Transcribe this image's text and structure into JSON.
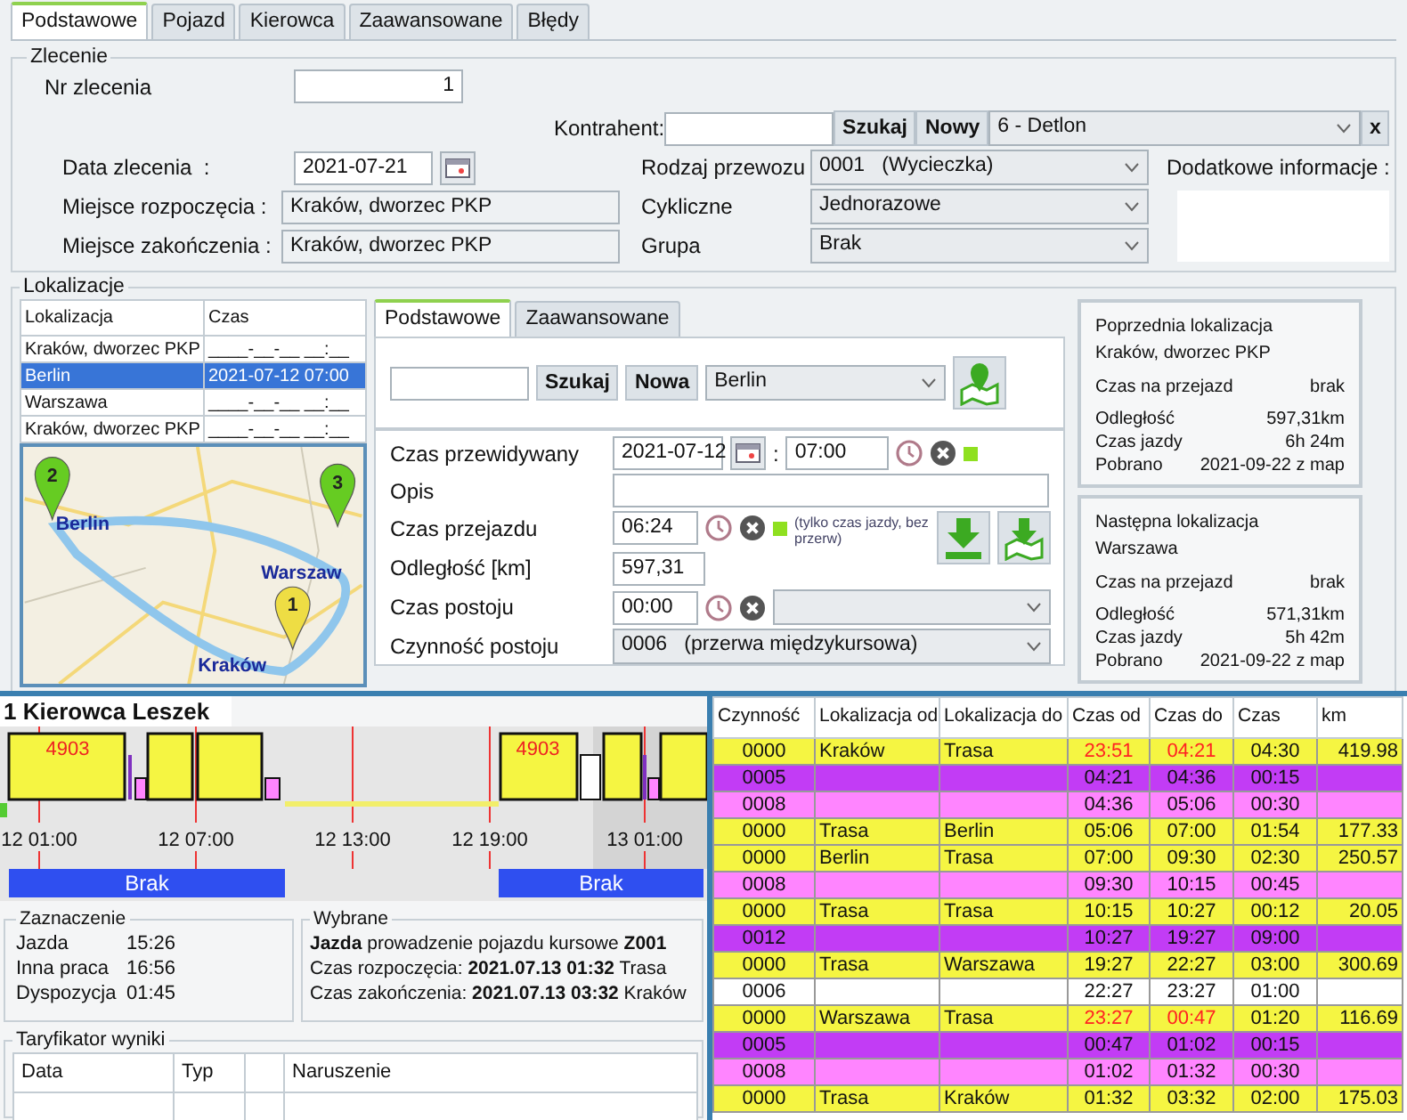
{
  "tabs": [
    {
      "label": "Podstawowe",
      "selected": true
    },
    {
      "label": "Pojazd",
      "selected": false
    },
    {
      "label": "Kierowca",
      "selected": false
    },
    {
      "label": "Zaawansowane",
      "selected": false
    },
    {
      "label": "Błędy",
      "selected": false
    }
  ],
  "zlecenie": {
    "legend": "Zlecenie",
    "left_fields": [
      {
        "label": "Nr zlecenia",
        "value": "1",
        "kind": "number"
      },
      {
        "label": "Data zlecenia  :",
        "value": "2021-07-21",
        "kind": "date"
      },
      {
        "label": "Miejsce rozpoczęcia :",
        "value": "Kraków, dworzec PKP",
        "kind": "readonly"
      },
      {
        "label": "Miejsce zakończenia :",
        "value": "Kraków, dworzec PKP",
        "kind": "readonly"
      }
    ],
    "kontrahent": {
      "label": "Kontrahent:",
      "search_button": "Szukaj",
      "new_button": "Nowy",
      "value": "6 - Detlon",
      "clear_button": "x"
    },
    "selects": [
      {
        "label": "Rodzaj przewozu",
        "value": "0001   (Wycieczka)"
      },
      {
        "label": "Cykliczne",
        "value": "Jednorazowe"
      },
      {
        "label": "Grupa",
        "value": "Brak"
      }
    ],
    "notes_label": "Dodatkowe informacje :"
  },
  "lokalizacje": {
    "legend": "Lokalizacje",
    "columns": [
      "Lokalizacja",
      "Czas"
    ],
    "rows": [
      {
        "name": "Kraków, dworzec PKP",
        "time": "____-__-__ __:__",
        "selected": false
      },
      {
        "name": "Berlin",
        "time": "2021-07-12 07:00",
        "selected": true
      },
      {
        "name": "Warszawa",
        "time": "____-__-__ __:__",
        "selected": false
      },
      {
        "name": "Kraków, dworzec PKP",
        "time": "____-__-__ __:__",
        "selected": false
      }
    ],
    "map": {
      "markers": [
        {
          "number": "2",
          "label": "Berlin",
          "color": "#66cc22"
        },
        {
          "number": "3",
          "label": "Warszaw",
          "color": "#66cc22"
        },
        {
          "number": "1",
          "label": "Kraków",
          "color": "#eedd44"
        }
      ]
    },
    "detail": {
      "tabs": [
        {
          "label": "Podstawowe",
          "selected": true
        },
        {
          "label": "Zaawansowane",
          "selected": false
        }
      ],
      "search_button": "Szukaj",
      "new_button": "Nowa",
      "location": "Berlin",
      "planned": {
        "label": "Czas przewidywany",
        "date": "2021-07-12",
        "separator": ":",
        "time": "07:00"
      },
      "description": {
        "label": "Opis"
      },
      "travel_time": {
        "label": "Czas przejazdu",
        "value": "06:24",
        "note": "(tylko czas jazdy, bez przerw)"
      },
      "distance": {
        "label": "Odległość [km]",
        "value": "597,31"
      },
      "stop_time": {
        "label": "Czas postoju",
        "value": "00:00"
      },
      "stop_activity": {
        "label": "Czynność postoju",
        "value": "0006   (przerwa międzykursowa)"
      }
    },
    "neighbors": [
      {
        "title": "Poprzednia lokalizacja",
        "name": "Kraków, dworzec PKP",
        "rows": [
          {
            "label": "Czas na przejazd",
            "value": "brak"
          },
          {
            "label": "Odległość",
            "value": "597,31km"
          },
          {
            "label": "Czas jazdy",
            "value": "6h 24m"
          },
          {
            "label": "Pobrano",
            "value": "2021-09-22 z map"
          }
        ]
      },
      {
        "title": "Następna lokalizacja",
        "name": "Warszawa",
        "rows": [
          {
            "label": "Czas na przejazd",
            "value": "brak"
          },
          {
            "label": "Odległość",
            "value": "571,31km"
          },
          {
            "label": "Czas jazdy",
            "value": "5h 42m"
          },
          {
            "label": "Pobrano",
            "value": "2021-09-22 z map"
          }
        ]
      }
    ]
  },
  "timeline": {
    "title": "1 Kierowca Leszek",
    "block_labels": [
      "4903",
      "4903"
    ],
    "ticks": [
      "12 01:00",
      "12 07:00",
      "12 13:00",
      "12 19:00",
      "13 01:00"
    ],
    "bars": [
      "Brak",
      "Brak"
    ]
  },
  "zaznaczenie": {
    "legend": "Zaznaczenie",
    "rows": [
      {
        "label": "Jazda",
        "value": "15:26"
      },
      {
        "label": "Inna praca",
        "value": "16:56"
      },
      {
        "label": "Dyspozycja",
        "value": "01:45"
      }
    ]
  },
  "wybrane": {
    "legend": "Wybrane",
    "lines": [
      "**Jazda** prowadzenie pojazdu kursowe **Z001**",
      "Czas rozpoczęcia: **2021.07.13 01:32** Trasa",
      "Czas zakończenia: **2021.07.13 03:32** Kraków"
    ]
  },
  "taryfikator": {
    "legend": "Taryfikator wyniki",
    "columns": [
      "Data",
      "Typ",
      "Naruszenie"
    ]
  },
  "activities": {
    "columns": [
      "Czynność",
      "Lokalizacja od",
      "Lokalizacja do",
      "Czas od",
      "Czas do",
      "Czas",
      "km"
    ],
    "rows": [
      {
        "code": "0000",
        "from": "Kraków",
        "to": "Trasa",
        "start": "23:51",
        "end": "04:21",
        "duration": "04:30",
        "km": "419.98",
        "color": "#f5f542",
        "time_alert": true
      },
      {
        "code": "0005",
        "start": "04:21",
        "end": "04:36",
        "duration": "00:15",
        "color": "#c23cf5",
        "time_alert": false
      },
      {
        "code": "0008",
        "start": "04:36",
        "end": "05:06",
        "duration": "00:30",
        "color": "#ff85ff",
        "time_alert": false
      },
      {
        "code": "0000",
        "from": "Trasa",
        "to": "Berlin",
        "start": "05:06",
        "end": "07:00",
        "duration": "01:54",
        "km": "177.33",
        "color": "#f5f542",
        "time_alert": false
      },
      {
        "code": "0000",
        "from": "Berlin",
        "to": "Trasa",
        "start": "07:00",
        "end": "09:30",
        "duration": "02:30",
        "km": "250.57",
        "color": "#f5f542",
        "time_alert": false
      },
      {
        "code": "0008",
        "start": "09:30",
        "end": "10:15",
        "duration": "00:45",
        "color": "#ff85ff",
        "time_alert": false
      },
      {
        "code": "0000",
        "from": "Trasa",
        "to": "Trasa",
        "start": "10:15",
        "end": "10:27",
        "duration": "00:12",
        "km": "20.05",
        "color": "#f5f542",
        "time_alert": false
      },
      {
        "code": "0012",
        "start": "10:27",
        "end": "19:27",
        "duration": "09:00",
        "color": "#c23cf5",
        "time_alert": false
      },
      {
        "code": "0000",
        "from": "Trasa",
        "to": "Warszawa",
        "start": "19:27",
        "end": "22:27",
        "duration": "03:00",
        "km": "300.69",
        "color": "#f5f542",
        "time_alert": false
      },
      {
        "code": "0006",
        "start": "22:27",
        "end": "23:27",
        "duration": "01:00",
        "color": "#ffffff",
        "time_alert": false
      },
      {
        "code": "0000",
        "from": "Warszawa",
        "to": "Trasa",
        "start": "23:27",
        "end": "00:47",
        "duration": "01:20",
        "km": "116.69",
        "color": "#f5f542",
        "time_alert": true
      },
      {
        "code": "0005",
        "start": "00:47",
        "end": "01:02",
        "duration": "00:15",
        "color": "#c23cf5",
        "time_alert": false
      },
      {
        "code": "0008",
        "start": "01:02",
        "end": "01:32",
        "duration": "00:30",
        "color": "#ff85ff",
        "time_alert": false
      },
      {
        "code": "0000",
        "from": "Trasa",
        "to": "Kraków",
        "start": "01:32",
        "end": "03:32",
        "duration": "02:00",
        "km": "175.03",
        "color": "#f5f542",
        "time_alert": false
      }
    ]
  }
}
